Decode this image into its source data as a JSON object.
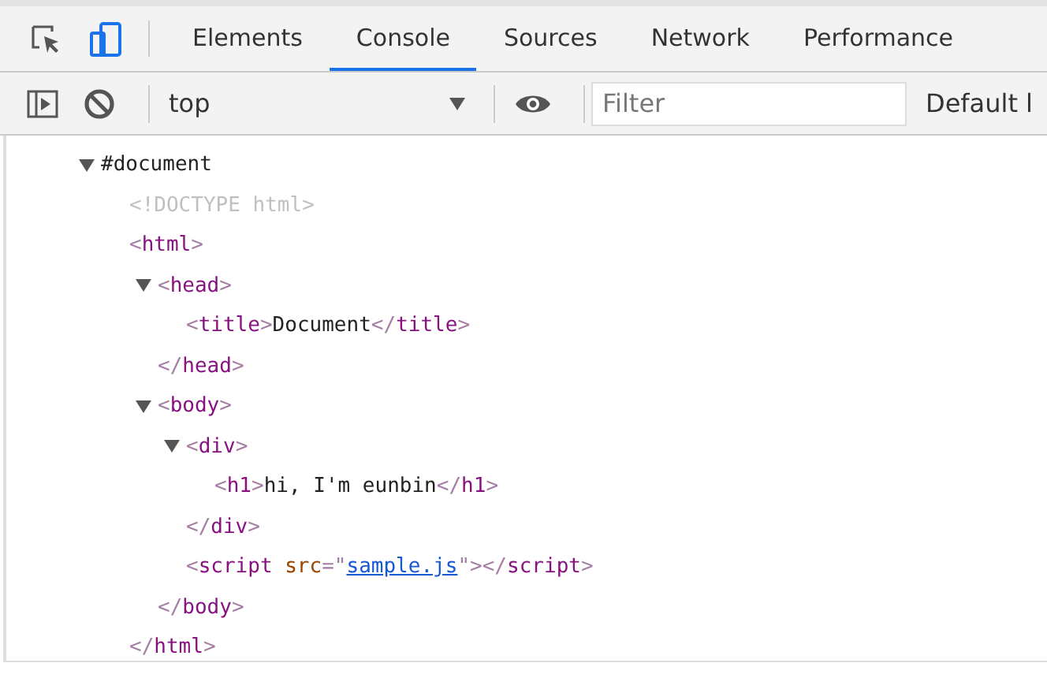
{
  "tabs": [
    {
      "label": "Elements",
      "selected": false
    },
    {
      "label": "Console",
      "selected": true
    },
    {
      "label": "Sources",
      "selected": false
    },
    {
      "label": "Network",
      "selected": false
    },
    {
      "label": "Performance",
      "selected": false
    }
  ],
  "device_toolbar_on": true,
  "console_toolbar": {
    "context": "top",
    "filter": {
      "placeholder": "Filter"
    },
    "levels": "Default l"
  },
  "tree": [
    {
      "expanded": true,
      "parts": [
        {
          "kind": "text",
          "text": "#document"
        }
      ],
      "children": [
        {
          "parts": [
            {
              "kind": "doctype",
              "text": "<!DOCTYPE html>"
            }
          ]
        },
        {
          "parts": [
            {
              "kind": "punct",
              "text": "<"
            },
            {
              "kind": "tag",
              "text": "html"
            },
            {
              "kind": "punct",
              "text": ">"
            }
          ],
          "close": [
            {
              "kind": "punct",
              "text": "</"
            },
            {
              "kind": "tag",
              "text": "html"
            },
            {
              "kind": "punct",
              "text": ">"
            }
          ],
          "children": [
            {
              "expanded": true,
              "parts": [
                {
                  "kind": "punct",
                  "text": "<"
                },
                {
                  "kind": "tag",
                  "text": "head"
                },
                {
                  "kind": "punct",
                  "text": ">"
                }
              ],
              "close": [
                {
                  "kind": "punct",
                  "text": "</"
                },
                {
                  "kind": "tag",
                  "text": "head"
                },
                {
                  "kind": "punct",
                  "text": ">"
                }
              ],
              "children": [
                {
                  "parts": [
                    {
                      "kind": "punct",
                      "text": "<"
                    },
                    {
                      "kind": "tag",
                      "text": "title"
                    },
                    {
                      "kind": "punct",
                      "text": ">"
                    },
                    {
                      "kind": "text",
                      "text": "Document"
                    },
                    {
                      "kind": "punct",
                      "text": "</"
                    },
                    {
                      "kind": "tag",
                      "text": "title"
                    },
                    {
                      "kind": "punct",
                      "text": ">"
                    }
                  ]
                }
              ]
            },
            {
              "expanded": true,
              "parts": [
                {
                  "kind": "punct",
                  "text": "<"
                },
                {
                  "kind": "tag",
                  "text": "body"
                },
                {
                  "kind": "punct",
                  "text": ">"
                }
              ],
              "close": [
                {
                  "kind": "punct",
                  "text": "</"
                },
                {
                  "kind": "tag",
                  "text": "body"
                },
                {
                  "kind": "punct",
                  "text": ">"
                }
              ],
              "children": [
                {
                  "expanded": true,
                  "parts": [
                    {
                      "kind": "punct",
                      "text": "<"
                    },
                    {
                      "kind": "tag",
                      "text": "div"
                    },
                    {
                      "kind": "punct",
                      "text": ">"
                    }
                  ],
                  "close": [
                    {
                      "kind": "punct",
                      "text": "</"
                    },
                    {
                      "kind": "tag",
                      "text": "div"
                    },
                    {
                      "kind": "punct",
                      "text": ">"
                    }
                  ],
                  "children": [
                    {
                      "parts": [
                        {
                          "kind": "punct",
                          "text": "<"
                        },
                        {
                          "kind": "tag",
                          "text": "h1"
                        },
                        {
                          "kind": "punct",
                          "text": ">"
                        },
                        {
                          "kind": "text",
                          "text": "hi, I'm eunbin"
                        },
                        {
                          "kind": "punct",
                          "text": "</"
                        },
                        {
                          "kind": "tag",
                          "text": "h1"
                        },
                        {
                          "kind": "punct",
                          "text": ">"
                        }
                      ]
                    }
                  ]
                },
                {
                  "parts": [
                    {
                      "kind": "punct",
                      "text": "<"
                    },
                    {
                      "kind": "tag",
                      "text": "script"
                    },
                    {
                      "kind": "attr",
                      "text": "src"
                    },
                    {
                      "kind": "punct",
                      "text": "=\""
                    },
                    {
                      "kind": "link",
                      "text": "sample.js"
                    },
                    {
                      "kind": "punct",
                      "text": "\"></"
                    },
                    {
                      "kind": "tag",
                      "text": "script"
                    },
                    {
                      "kind": "punct",
                      "text": ">"
                    }
                  ]
                }
              ]
            }
          ]
        }
      ]
    }
  ]
}
